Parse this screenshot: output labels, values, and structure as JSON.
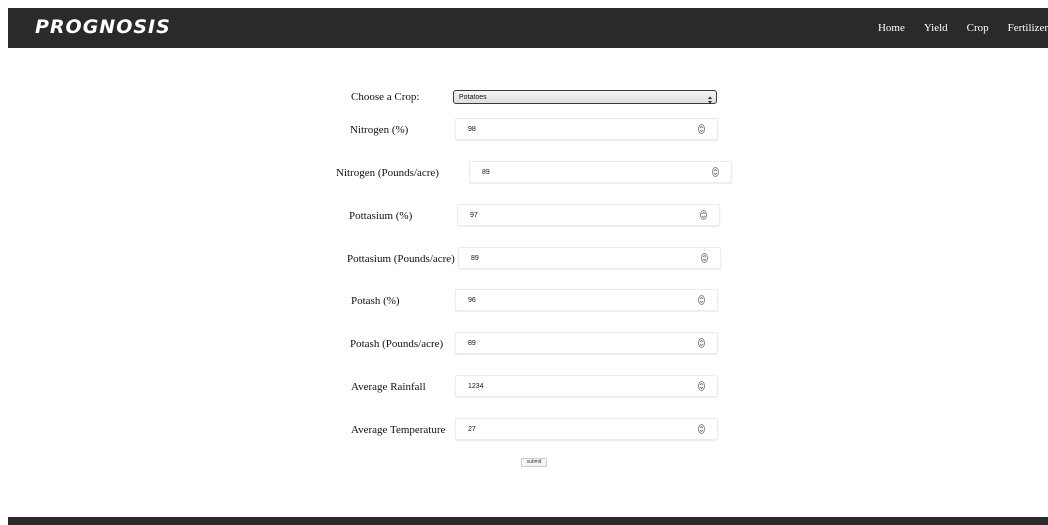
{
  "navbar": {
    "brand": "PROGNOSIS",
    "links": [
      "Home",
      "Yield",
      "Crop",
      "Fertilizer"
    ]
  },
  "form": {
    "crop_label": "Choose a Crop:",
    "crop_selected": "Potatoes",
    "fields": [
      {
        "label": "Nitrogen (%)",
        "value": "98"
      },
      {
        "label": "Nitrogen (Pounds/acre)",
        "value": "89"
      },
      {
        "label": "Pottasium (%)",
        "value": "97"
      },
      {
        "label": "Pottasium (Pounds/acre)",
        "value": "89"
      },
      {
        "label": "Potash (%)",
        "value": "96"
      },
      {
        "label": "Potash (Pounds/acre)",
        "value": "89"
      },
      {
        "label": "Average Rainfall",
        "value": "1234"
      },
      {
        "label": "Average Temperature",
        "value": "27"
      }
    ],
    "submit_label": "submit"
  },
  "colors": {
    "navbar_bg": "#2a2a2a",
    "navbar_text": "#ffffff",
    "page_bg": "#ffffff"
  },
  "icons": {
    "stepper": "up-down-stepper-icon",
    "select_arrows": "select-updown-arrows-icon"
  }
}
